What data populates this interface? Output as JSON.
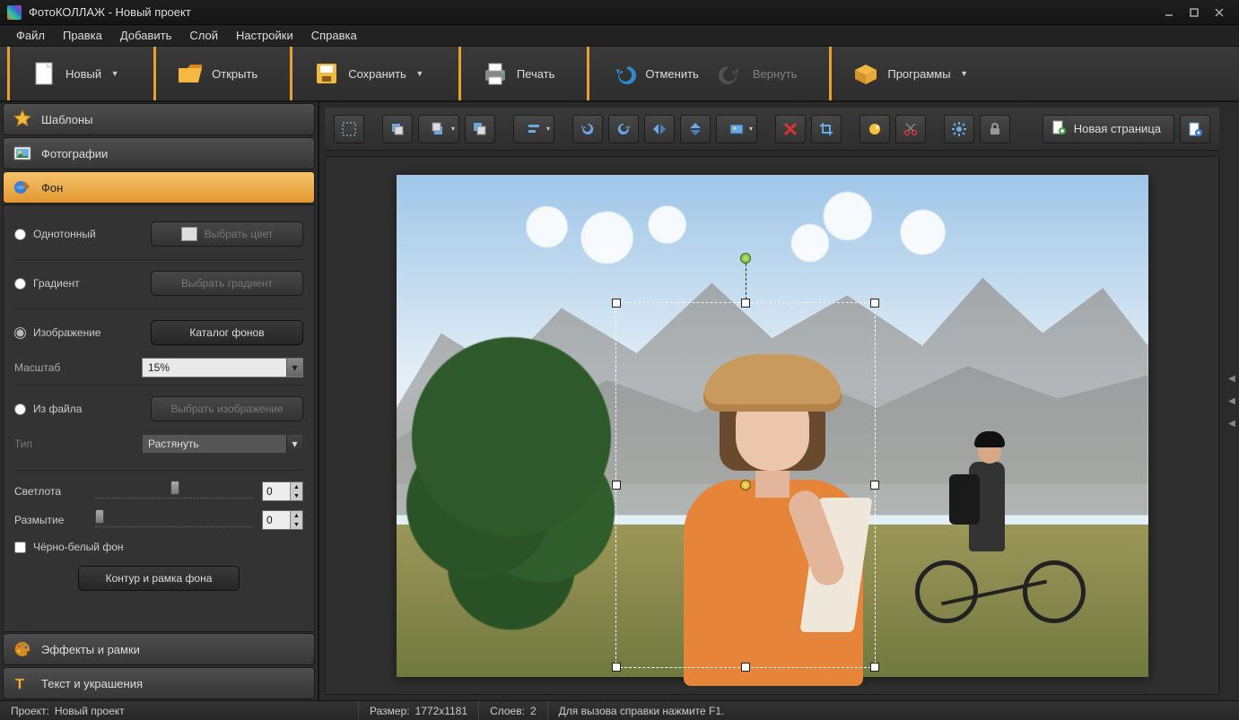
{
  "title": "ФотоКОЛЛАЖ - Новый проект",
  "menu": [
    "Файл",
    "Правка",
    "Добавить",
    "Слой",
    "Настройки",
    "Справка"
  ],
  "toolbar": {
    "new": "Новый",
    "open": "Открыть",
    "save": "Сохранить",
    "print": "Печать",
    "undo": "Отменить",
    "redo": "Вернуть",
    "programs": "Программы"
  },
  "sidebar": {
    "templates": "Шаблоны",
    "photos": "Фотографии",
    "background": "Фон",
    "effects": "Эффекты и рамки",
    "text": "Текст и украшения"
  },
  "bg_panel": {
    "solid": "Однотонный",
    "choose_color": "Выбрать цвет",
    "gradient": "Градиент",
    "choose_gradient": "Выбрать градиент",
    "image": "Изображение",
    "catalog": "Каталог фонов",
    "scale_label": "Масштаб",
    "scale_value": "15%",
    "from_file": "Из файла",
    "choose_image": "Выбрать изображение",
    "type_label": "Тип",
    "type_value": "Растянуть",
    "brightness_label": "Светлота",
    "brightness_value": "0",
    "blur_label": "Размытие",
    "blur_value": "0",
    "bw": "Чёрно-белый фон",
    "contour": "Контур и рамка фона"
  },
  "sectoolbar": {
    "new_page": "Новая страница"
  },
  "status": {
    "project_label": "Проект:",
    "project_value": "Новый проект",
    "size_label": "Размер:",
    "size_value": "1772x1181",
    "layers_label": "Слоев:",
    "layers_value": "2",
    "help": "Для вызова справки нажмите F1."
  }
}
